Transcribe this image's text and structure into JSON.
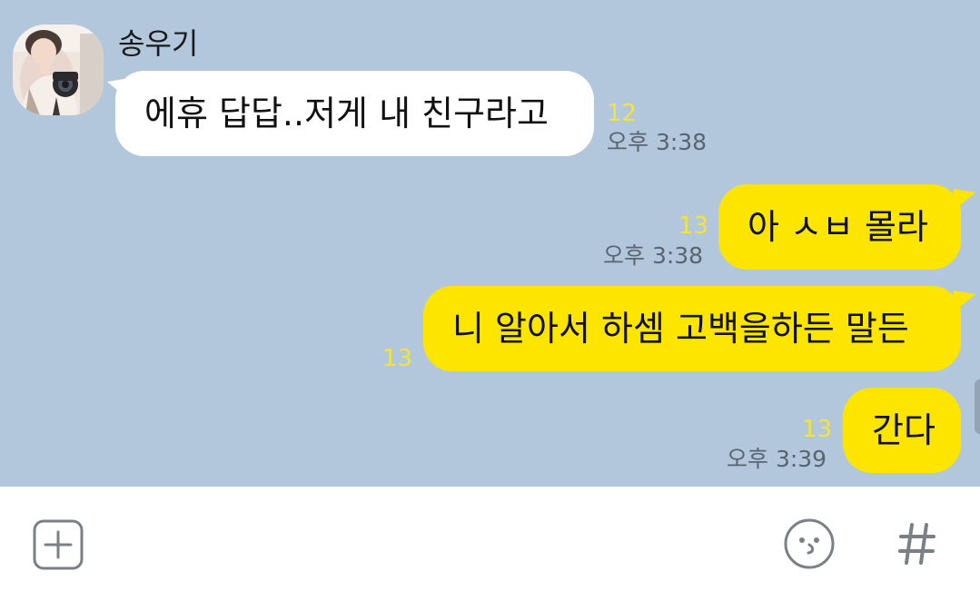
{
  "chat": {
    "sender": {
      "name": "송우기",
      "avatar_icon": "profile-photo"
    },
    "messages": [
      {
        "side": "left",
        "text": "에휴 답답..저게 내 친구라고",
        "unread": "12",
        "time": "오후 3:38"
      },
      {
        "side": "right",
        "text": "아 ㅅㅂ 몰라",
        "unread": "13",
        "time": "오후 3:38"
      },
      {
        "side": "right",
        "text": "니 알아서 하셈 고백을하든 말든",
        "unread": "13",
        "time": ""
      },
      {
        "side": "right",
        "text": "간다",
        "unread": "13",
        "time": "오후 3:39"
      }
    ]
  },
  "input_bar": {
    "attach_icon": "plus-square-icon",
    "emoji_icon": "emoji-icon",
    "hash_icon": "hashtag-icon"
  },
  "colors": {
    "chat_background": "#b2c7dc",
    "my_bubble": "#fee500",
    "their_bubble": "#ffffff",
    "unread_count": "#f5e33a",
    "timestamp": "#5a6470"
  }
}
